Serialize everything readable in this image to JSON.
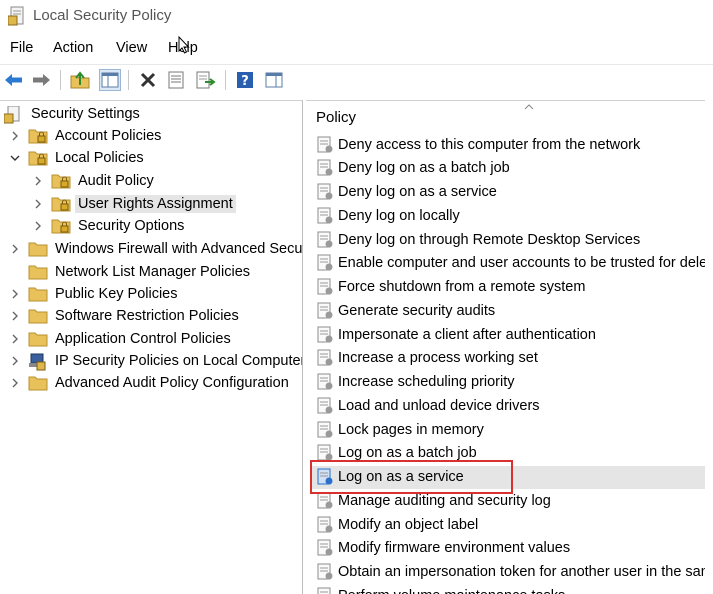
{
  "window": {
    "title": "Local Security Policy"
  },
  "menu": [
    "File",
    "Action",
    "View",
    "Help"
  ],
  "toolbar": {
    "buttons": [
      "back-arrow-icon",
      "forward-arrow-icon",
      "up-folder-icon",
      "show-hide-tree-icon",
      "delete-icon",
      "properties-icon",
      "export-list-icon",
      "help-icon",
      "action-pane-icon"
    ]
  },
  "tree": {
    "root": "Security Settings",
    "items": [
      {
        "label": "Account Policies"
      },
      {
        "label": "Local Policies"
      },
      {
        "label": "Audit Policy"
      },
      {
        "label": "User Rights Assignment"
      },
      {
        "label": "Security Options"
      },
      {
        "label": "Windows Firewall with Advanced Security"
      },
      {
        "label": "Network List Manager Policies"
      },
      {
        "label": "Public Key Policies"
      },
      {
        "label": "Software Restriction Policies"
      },
      {
        "label": "Application Control Policies"
      },
      {
        "label": "IP Security Policies on Local Computer"
      },
      {
        "label": "Advanced Audit Policy Configuration"
      }
    ]
  },
  "list": {
    "column_header": "Policy",
    "rows": [
      "Deny access to this computer from the network",
      "Deny log on as a batch job",
      "Deny log on as a service",
      "Deny log on locally",
      "Deny log on through Remote Desktop Services",
      "Enable computer and user accounts to be trusted for delegation",
      "Force shutdown from a remote system",
      "Generate security audits",
      "Impersonate a client after authentication",
      "Increase a process working set",
      "Increase scheduling priority",
      "Load and unload device drivers",
      "Lock pages in memory",
      "Log on as a batch job",
      "Log on as a service",
      "Manage auditing and security log",
      "Modify an object label",
      "Modify firmware environment values",
      "Obtain an impersonation token for another user in the same session",
      "Perform volume maintenance tasks"
    ],
    "selected": "Log on as a service"
  },
  "colors": {
    "highlight": "#d9312d",
    "selection": "#e5e5e5",
    "folder": "#e8c15a",
    "accent_blue": "#2a6fc9"
  }
}
